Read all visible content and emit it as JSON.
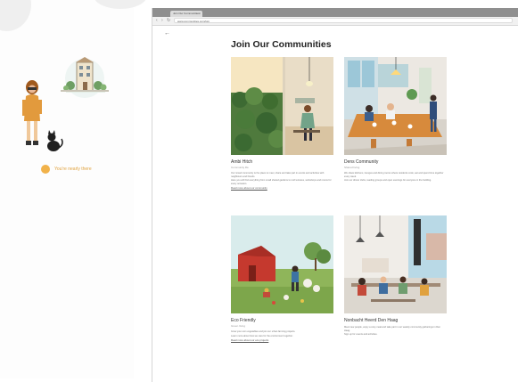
{
  "sidebar": {
    "progress_text": "You're nearly there"
  },
  "browser": {
    "tab_title": "Join Our Communities",
    "url": "www.communities.com/join"
  },
  "page": {
    "title": "Join Our Communities"
  },
  "cards": [
    {
      "title": "Ambi Hitch",
      "subtitle": "Community life",
      "body": [
        "Our mixed community is the place to meet, share and take part in events and activities with neighbours and friends.",
        "Here you will find everything from small shared gardens to roof terraces, workshops and rooms for every occasion."
      ],
      "link": "Read more about our community"
    },
    {
      "title": "Dens Community",
      "subtitle": "Shared living",
      "body": [
        "We share kitchens, lounges and dining rooms where residents cook, eat and spend time together every week.",
        "Join our dinner clubs, reading groups and open evenings for everyone in the building."
      ],
      "link": ""
    },
    {
      "title": "Eco Friendly",
      "subtitle": "Green living",
      "body": [
        "Grow your own vegetables and join our urban farming projects.",
        "Learn more about how we care for the environment together."
      ],
      "link": "Read more about our eco projects"
    },
    {
      "title": "Nonbacht Heerd Den Haag",
      "subtitle": "",
      "body": [
        "Meet new people, enjoy a cosy meal and take part in our weekly community gatherings in Den Haag.",
        "Sign up for events and activities."
      ],
      "link": ""
    }
  ],
  "colors": {
    "accent": "#f1b24a",
    "titlebar": "#8f8f8f",
    "title_text": "#222222"
  }
}
